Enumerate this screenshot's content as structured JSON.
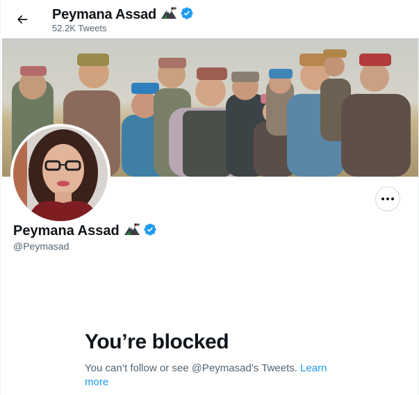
{
  "header": {
    "name": "Peymana Assad",
    "tweet_count": "52.2K Tweets"
  },
  "profile": {
    "name": "Peymana Assad",
    "handle": "@Peymasad",
    "name_emoji": "mountain-flag-emoji",
    "verified_icon": "verified-badge-icon"
  },
  "blocked": {
    "title": "You’re blocked",
    "message": "You can’t follow or see @Peymasad’s Tweets.",
    "link_label_1": "Learn",
    "link_label_2": "more"
  },
  "colors": {
    "accent": "#1d9bf0",
    "text_primary": "#0f1419",
    "text_secondary": "#536471",
    "border": "#cfd9de"
  },
  "icons": {
    "back": "arrow-left-icon",
    "more": "more-horizontal-icon"
  }
}
